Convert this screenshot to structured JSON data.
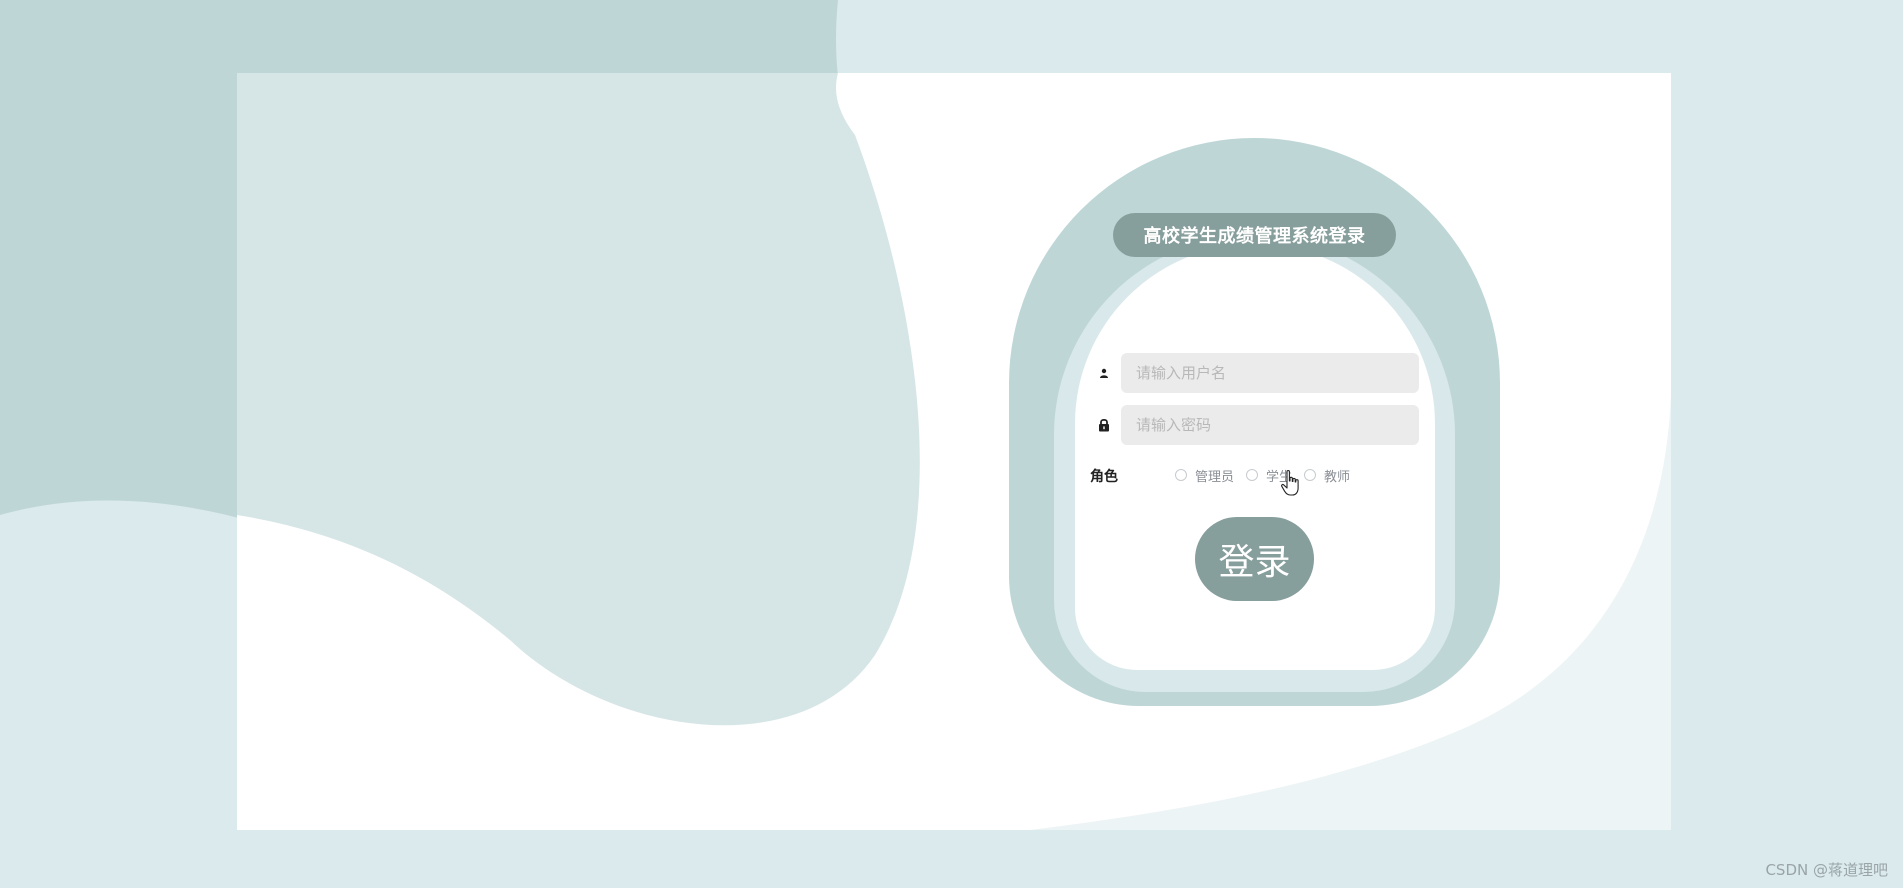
{
  "login_form": {
    "title": "高校学生成绩管理系统登录",
    "username_placeholder": "请输入用户名",
    "password_placeholder": "请输入密码",
    "username_icon": "user-icon",
    "password_icon": "lock-icon",
    "role_label": "角色",
    "roles": [
      {
        "label": "管理员",
        "selected": false
      },
      {
        "label": "学生",
        "selected": false
      },
      {
        "label": "教师",
        "selected": false
      }
    ],
    "login_button_label": "登录"
  },
  "watermark": "CSDN @蒋道理吧",
  "colors": {
    "page_background": "#dbeaec",
    "card_outer": "#bfd6d7",
    "card_ring": "#d9e9eb",
    "accent": "#869e9c",
    "input_background": "#ebebeb"
  }
}
